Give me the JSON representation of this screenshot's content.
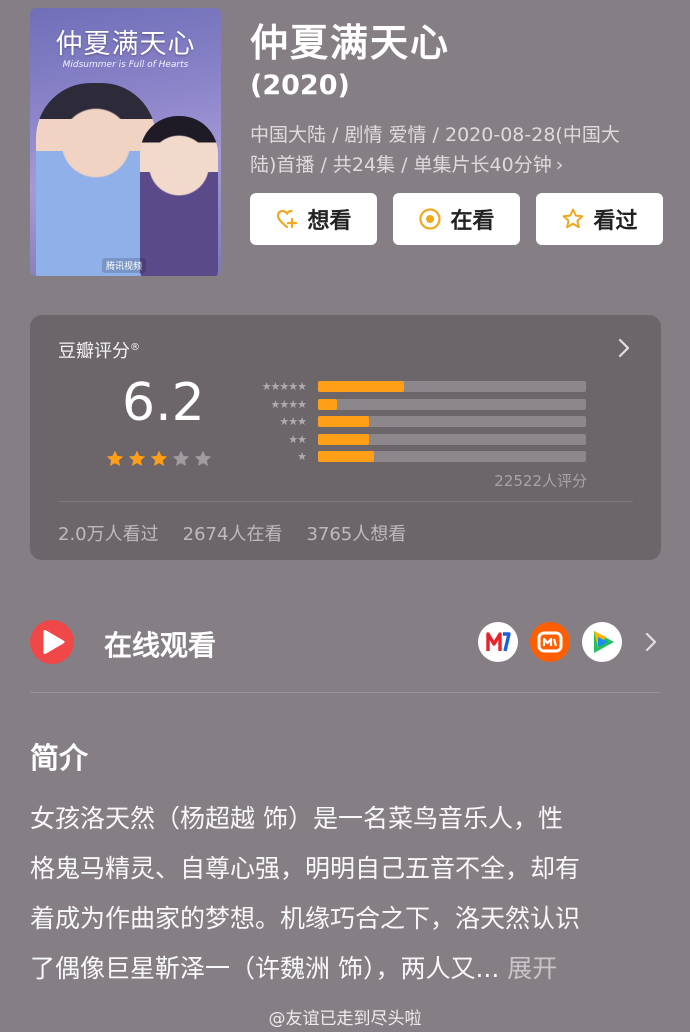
{
  "poster": {
    "title_art": "仲夏满天心",
    "subtitle_art": "Midsummer is Full of Hearts",
    "logo_text": "腾讯视频"
  },
  "header": {
    "title": "仲夏满天心",
    "year": "(2020)",
    "meta_line1": "中国大陆 / 剧情 爱情 / 2020-08-28(中国大",
    "meta_line2": "陆)首播 / 共24集 / 单集片长40分钟"
  },
  "actions": {
    "want_label": "想看",
    "watching_label": "在看",
    "watched_label": "看过"
  },
  "rating": {
    "label": "豆瓣评分",
    "registered_mark": "®",
    "score": "6.2",
    "stars": 3,
    "star_total": 5,
    "distribution": [
      {
        "stars": 5,
        "glyphs": "★★★★★",
        "fraction": 0.32
      },
      {
        "stars": 4,
        "glyphs": "★★★★",
        "fraction": 0.07
      },
      {
        "stars": 3,
        "glyphs": "★★★",
        "fraction": 0.19
      },
      {
        "stars": 2,
        "glyphs": "★★",
        "fraction": 0.19
      },
      {
        "stars": 1,
        "glyphs": "★",
        "fraction": 0.21
      }
    ],
    "raters": "22522人评分",
    "watched": "2.0万人看过",
    "watching": "2674人在看",
    "want": "3765人想看"
  },
  "watch": {
    "label": "在线观看",
    "platforms": [
      {
        "name": "mgtv-icon",
        "color": "#ffffff"
      },
      {
        "name": "mangotv-icon",
        "color": "#ff5f00"
      },
      {
        "name": "tencent-video-icon",
        "color": "#ffffff"
      }
    ]
  },
  "intro": {
    "title": "简介",
    "line1": "女孩洛天然（杨超越 饰）是一名菜鸟音乐人，性",
    "line2": "格鬼马精灵、自尊心强，明明自己五音不全，却有",
    "line3": "着成为作曲家的梦想。机缘巧合之下，洛天然认识",
    "line4": "了偶像巨星靳泽一（许魏洲 饰），两人又...",
    "more": "展开"
  },
  "watermark": "@友谊已走到尽头啦",
  "colors": {
    "background": "#857e84",
    "card": "#6c666b",
    "accent": "#ff9f17",
    "play_red": "#f04848"
  }
}
